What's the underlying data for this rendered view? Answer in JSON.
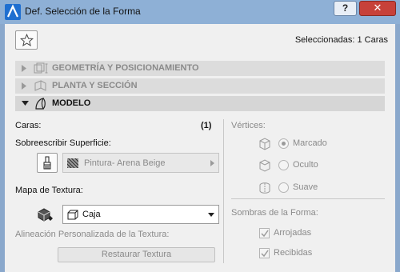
{
  "window": {
    "title": "Def. Selección de la Forma",
    "help_label": "?",
    "close_label": "✕"
  },
  "header": {
    "selected_text": "Seleccionadas: 1 Caras"
  },
  "sections": [
    {
      "label": "GEOMETRÍA Y POSICIONAMIENTO",
      "expanded": false,
      "icon": "geometry-icon"
    },
    {
      "label": "PLANTA Y SECCIÓN",
      "expanded": false,
      "icon": "plan-section-icon"
    },
    {
      "label": "MODELO",
      "expanded": true,
      "icon": "model-icon"
    }
  ],
  "model": {
    "caras_label": "Caras:",
    "caras_count": "(1)",
    "override_label": "Sobreescribir Superficie:",
    "surface_value": "Pintura- Arena Beige",
    "texture_map_label": "Mapa de Textura:",
    "texture_map_value": "Caja",
    "custom_alignment_label": "Alineación Personalizada de la Textura:",
    "restore_button_label": "Restaurar Textura"
  },
  "vertices": {
    "label": "Vértices:",
    "options": [
      {
        "label": "Marcado",
        "selected": true
      },
      {
        "label": "Oculto",
        "selected": false
      },
      {
        "label": "Suave",
        "selected": false
      }
    ]
  },
  "shadows": {
    "label": "Sombras de la Forma:",
    "options": [
      {
        "label": "Arrojadas",
        "checked": true
      },
      {
        "label": "Recibidas",
        "checked": true
      }
    ]
  },
  "colors": {
    "titlebar": "#8eb0d6",
    "close": "#c7413a",
    "panel": "#f0f0f0",
    "disabled_text": "#8a8a8a"
  }
}
